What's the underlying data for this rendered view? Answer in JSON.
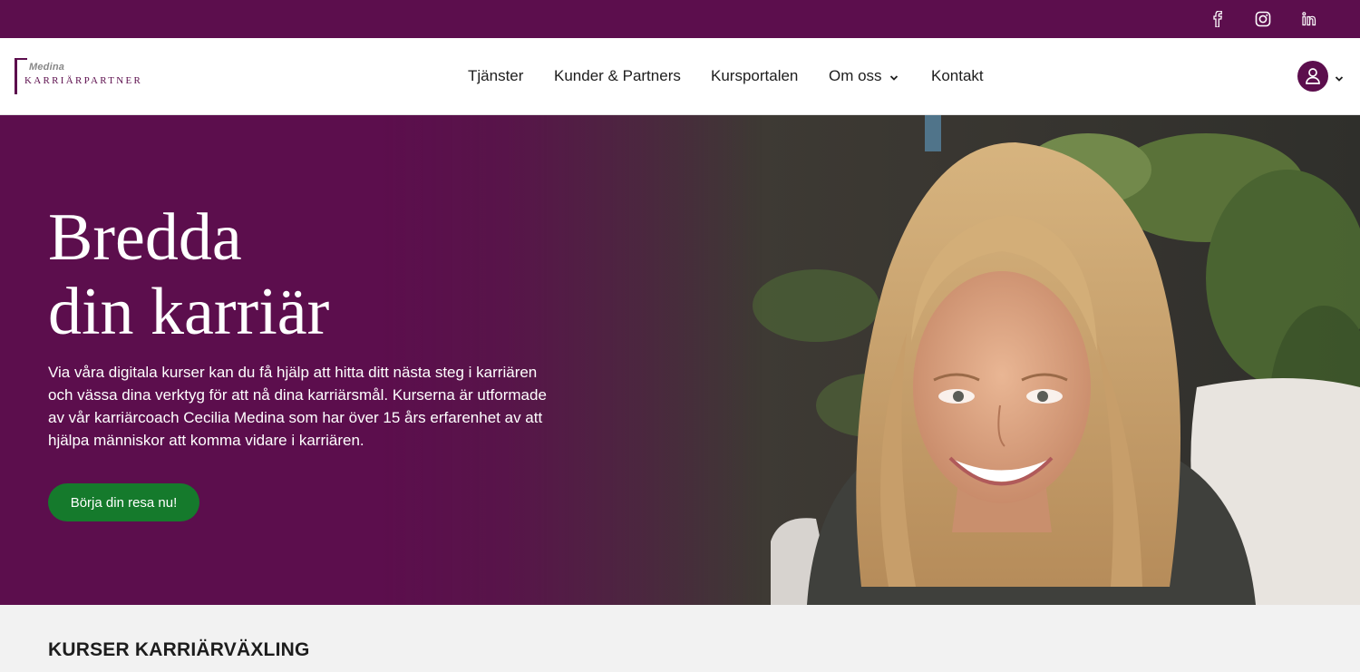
{
  "topbar": {
    "social": [
      {
        "icon": "facebook-icon",
        "glyph": "f"
      },
      {
        "icon": "instagram-icon",
        "glyph": ""
      },
      {
        "icon": "linkedin-icon",
        "glyph": "in"
      }
    ]
  },
  "header": {
    "logo_top": "Medina",
    "logo_main": "KARRIÄRPARTNER",
    "nav": [
      {
        "label": "Tjänster"
      },
      {
        "label": "Kunder & Partners"
      },
      {
        "label": "Kursportalen"
      },
      {
        "label": "Om oss",
        "has_dropdown": true
      },
      {
        "label": "Kontakt"
      }
    ],
    "account_icon": "user-icon"
  },
  "hero": {
    "title_line1": "Bredda",
    "title_line2": "din karriär",
    "text": "Via våra digitala kurser kan du få hjälp att hitta ditt nästa steg i karriären och vässa dina verktyg för att nå dina karriärsmål. Kurserna är utformade av vår karriärcoach Cecilia Medina som har över 15 års erfarenhet av att hjälpa människor att komma vidare i karriären.",
    "cta": "Börja din resa nu!"
  },
  "courses": {
    "heading_bold": "KURSER",
    "heading_rest": " KARRIÄRVÄXLING"
  },
  "colors": {
    "brand_purple": "#5c0e4d",
    "cta_green": "#157a2c",
    "section_bg": "#f2f2f2"
  }
}
